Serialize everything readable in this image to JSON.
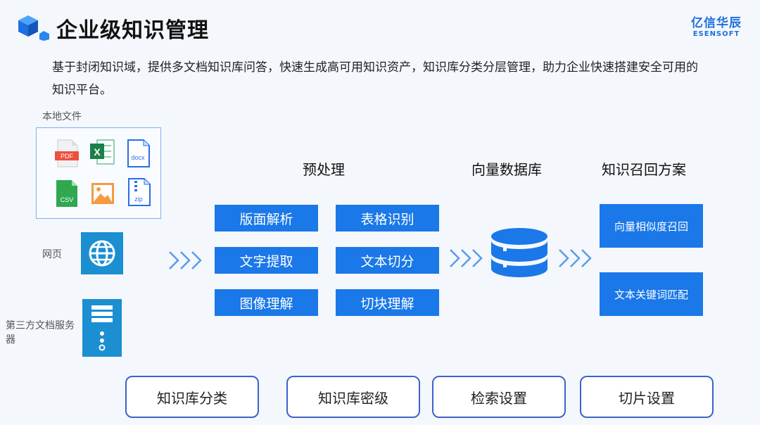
{
  "header": {
    "title": "企业级知识管理",
    "brand_cn": "亿信华辰",
    "brand_en": "ESENSOFT"
  },
  "description": "基于封闭知识域，提供多文档知识库问答，快速生成高可用知识资产，知识库分类分层管理，助力企业快速搭建安全可用的知识平台。",
  "sources": {
    "local_label": "本地文件",
    "file_types": {
      "pdf": "PDF",
      "excel": "X",
      "docx": "docx",
      "csv": "CSV",
      "zip": "zip"
    },
    "web_label": "网页",
    "server_label": "第三方文档服务器"
  },
  "preprocess": {
    "title": "预处理",
    "items": [
      "版面解析",
      "表格识别",
      "文字提取",
      "文本切分",
      "图像理解",
      "切块理解"
    ]
  },
  "vector_db": {
    "title": "向量数据库"
  },
  "recall": {
    "title": "知识召回方案",
    "items": [
      "向量相似度召回",
      "文本关键词匹配"
    ]
  },
  "bottom_buttons": [
    "知识库分类",
    "知识库密级",
    "检索设置",
    "切片设置"
  ],
  "colors": {
    "accent": "#1a78e8",
    "icon_blue": "#1b8fd1",
    "button_border": "#3e62c8"
  }
}
